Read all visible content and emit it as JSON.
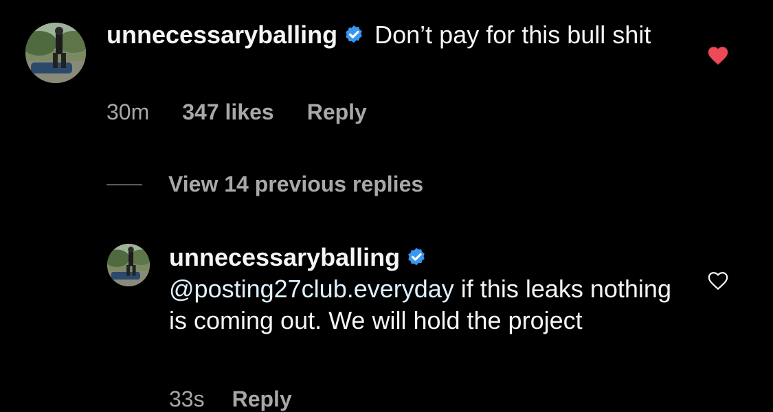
{
  "colors": {
    "background": "#000000",
    "text": "#f5f5f5",
    "secondary_text": "#a8a8a8",
    "liked_heart": "#ed4956",
    "verified_badge": "#3897f0"
  },
  "comment": {
    "username": "unnecessaryballing",
    "verified": true,
    "text": " Don’t pay for this bull shit",
    "time": "30m",
    "likes": "347 likes",
    "reply_label": "Reply",
    "liked": true,
    "heart_icon": "heart-filled-icon"
  },
  "view_replies": {
    "label": "View 14 previous replies"
  },
  "reply": {
    "username": "unnecessaryballing",
    "verified": true,
    "mention": "@posting27club.everyday",
    "text": " if this leaks nothing is coming out. We will hold the project",
    "time": "33s",
    "reply_label": "Reply",
    "liked": false,
    "heart_icon": "heart-outline-icon"
  }
}
